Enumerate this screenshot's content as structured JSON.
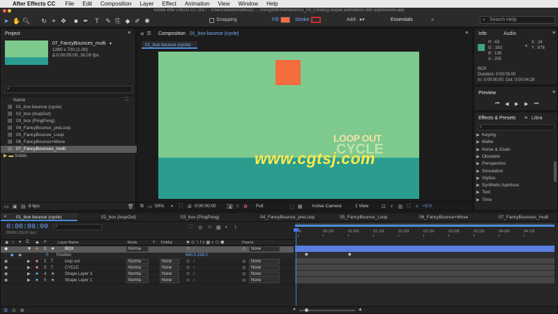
{
  "menubar": {
    "app_name": "After Effects CC",
    "items": [
      "File",
      "Edit",
      "Composition",
      "Layer",
      "Effect",
      "Animation",
      "View",
      "Window",
      "Help"
    ]
  },
  "toolbar": {
    "title": "Adobe After Effects CC 2017 - /Users/alandemafiles/D ... orkingWithAnimation/02_09_Creating looped animations with expressions.aep",
    "snapping_label": "Snapping",
    "fill_label": "Fill:",
    "stroke_label": "Stroke:",
    "add_label": "Add:",
    "workspace_label": "Essentials",
    "search_placeholder": "Search Help",
    "fill_color": "#ff6b3d"
  },
  "project": {
    "tab_label": "Project",
    "selected_name": "07_FancyBounces_multi",
    "selected_size": "1280 x 720 (1.00)",
    "selected_duration": "Δ 0:00:05:00, 30.00 fps",
    "search_glyph": "⌕",
    "name_header": "Name",
    "items": [
      {
        "name": "01_box bounce (cycle)",
        "type": "comp"
      },
      {
        "name": "02_box (loopOut)",
        "type": "comp"
      },
      {
        "name": "03_box (PingPong)",
        "type": "comp"
      },
      {
        "name": "04_FancyBounce_preLoop",
        "type": "comp"
      },
      {
        "name": "05_FancyBounce_Loop",
        "type": "comp"
      },
      {
        "name": "06_FancyBounce+Move",
        "type": "comp"
      },
      {
        "name": "07_FancyBounces_multi",
        "type": "comp"
      },
      {
        "name": "Solids",
        "type": "folder"
      }
    ],
    "bpc": "8 bpc"
  },
  "composition": {
    "tab_prefix": "Composition",
    "tab_name": "01_box bounce (cycle)",
    "sub_tab": "01_box bounce (cycle)",
    "overlay_line1": "LOOP OUT",
    "overlay_line2": "CYCLE",
    "watermark": "www.cgtsj.com",
    "zoom": "50%",
    "timecode": "0:00:00:00",
    "resolution": "Full",
    "camera": "Active Camera",
    "views": "1 View",
    "exposure": "+0.0",
    "bg_color": "#7ec98e",
    "ground_color": "#2a9d8f",
    "box_color": "#f26c3d",
    "text_color": "#f2e3a6"
  },
  "info": {
    "tab_label": "Info",
    "audio_tab": "Audio",
    "r": "R : 63",
    "g": "G : 163",
    "b": "B : 136",
    "a": "A : 255",
    "x": "X : 24",
    "y": "Y : 676",
    "swatch_color": "#3fa388",
    "layer_name": "BOX",
    "duration": "Duration: 0:00:05:00",
    "in_out": "In: 0:00:00:00, Out: 0:00:04:29"
  },
  "preview": {
    "tab_label": "Preview"
  },
  "effects": {
    "tab_label": "Effects & Presets",
    "libraries_tab": "Libra",
    "search_glyph": "⌕",
    "items": [
      "Keying",
      "Matte",
      "Noise & Grain",
      "Obsolete",
      "Perspective",
      "Simulation",
      "Stylize",
      "Synthetic Aperture",
      "Text",
      "Time"
    ]
  },
  "timeline": {
    "tabs": [
      "01_box bounce (cycle)",
      "02_box (loopOut)",
      "03_box (PingPong)",
      "04_FancyBounce_preLoop",
      "05_FancyBounce_Loop",
      "06_FancyBounce+Move",
      "07_FancyBounces_multi"
    ],
    "timecode": "0:00:00:00",
    "frame_info": "00000 (30.00 fps)",
    "col_layer_name": "Layer Name",
    "col_mode": "Mode",
    "col_t": "T",
    "col_trkmat": "TrkMat",
    "col_parent": "Parent",
    "ruler_labels": [
      "0f",
      "00:15f",
      "01:00f",
      "01:15f",
      "02:00f",
      "02:15f",
      "03:00f",
      "03:15f",
      "04:00f",
      "04:15f"
    ],
    "layers": [
      {
        "num": "1",
        "name": "BOX",
        "type": "★",
        "mode": "Norma",
        "trkmat": "",
        "parent": "None",
        "selected": true
      },
      {
        "num": "2",
        "name": "loop out",
        "type": "T",
        "mode": "Norma",
        "trkmat": "None",
        "parent": "None",
        "selected": false
      },
      {
        "num": "3",
        "name": "CYCLE",
        "type": "T",
        "mode": "Norma",
        "trkmat": "None",
        "parent": "None",
        "selected": false
      },
      {
        "num": "4",
        "name": "Shape Layer 3",
        "type": "★",
        "mode": "Norma",
        "trkmat": "None",
        "parent": "None",
        "selected": false
      },
      {
        "num": "5",
        "name": "Shape Layer 1",
        "type": "★",
        "mode": "Norma",
        "trkmat": "None",
        "parent": "None",
        "selected": false
      }
    ],
    "position_label": "Position",
    "position_value": "640.0,158.0"
  }
}
